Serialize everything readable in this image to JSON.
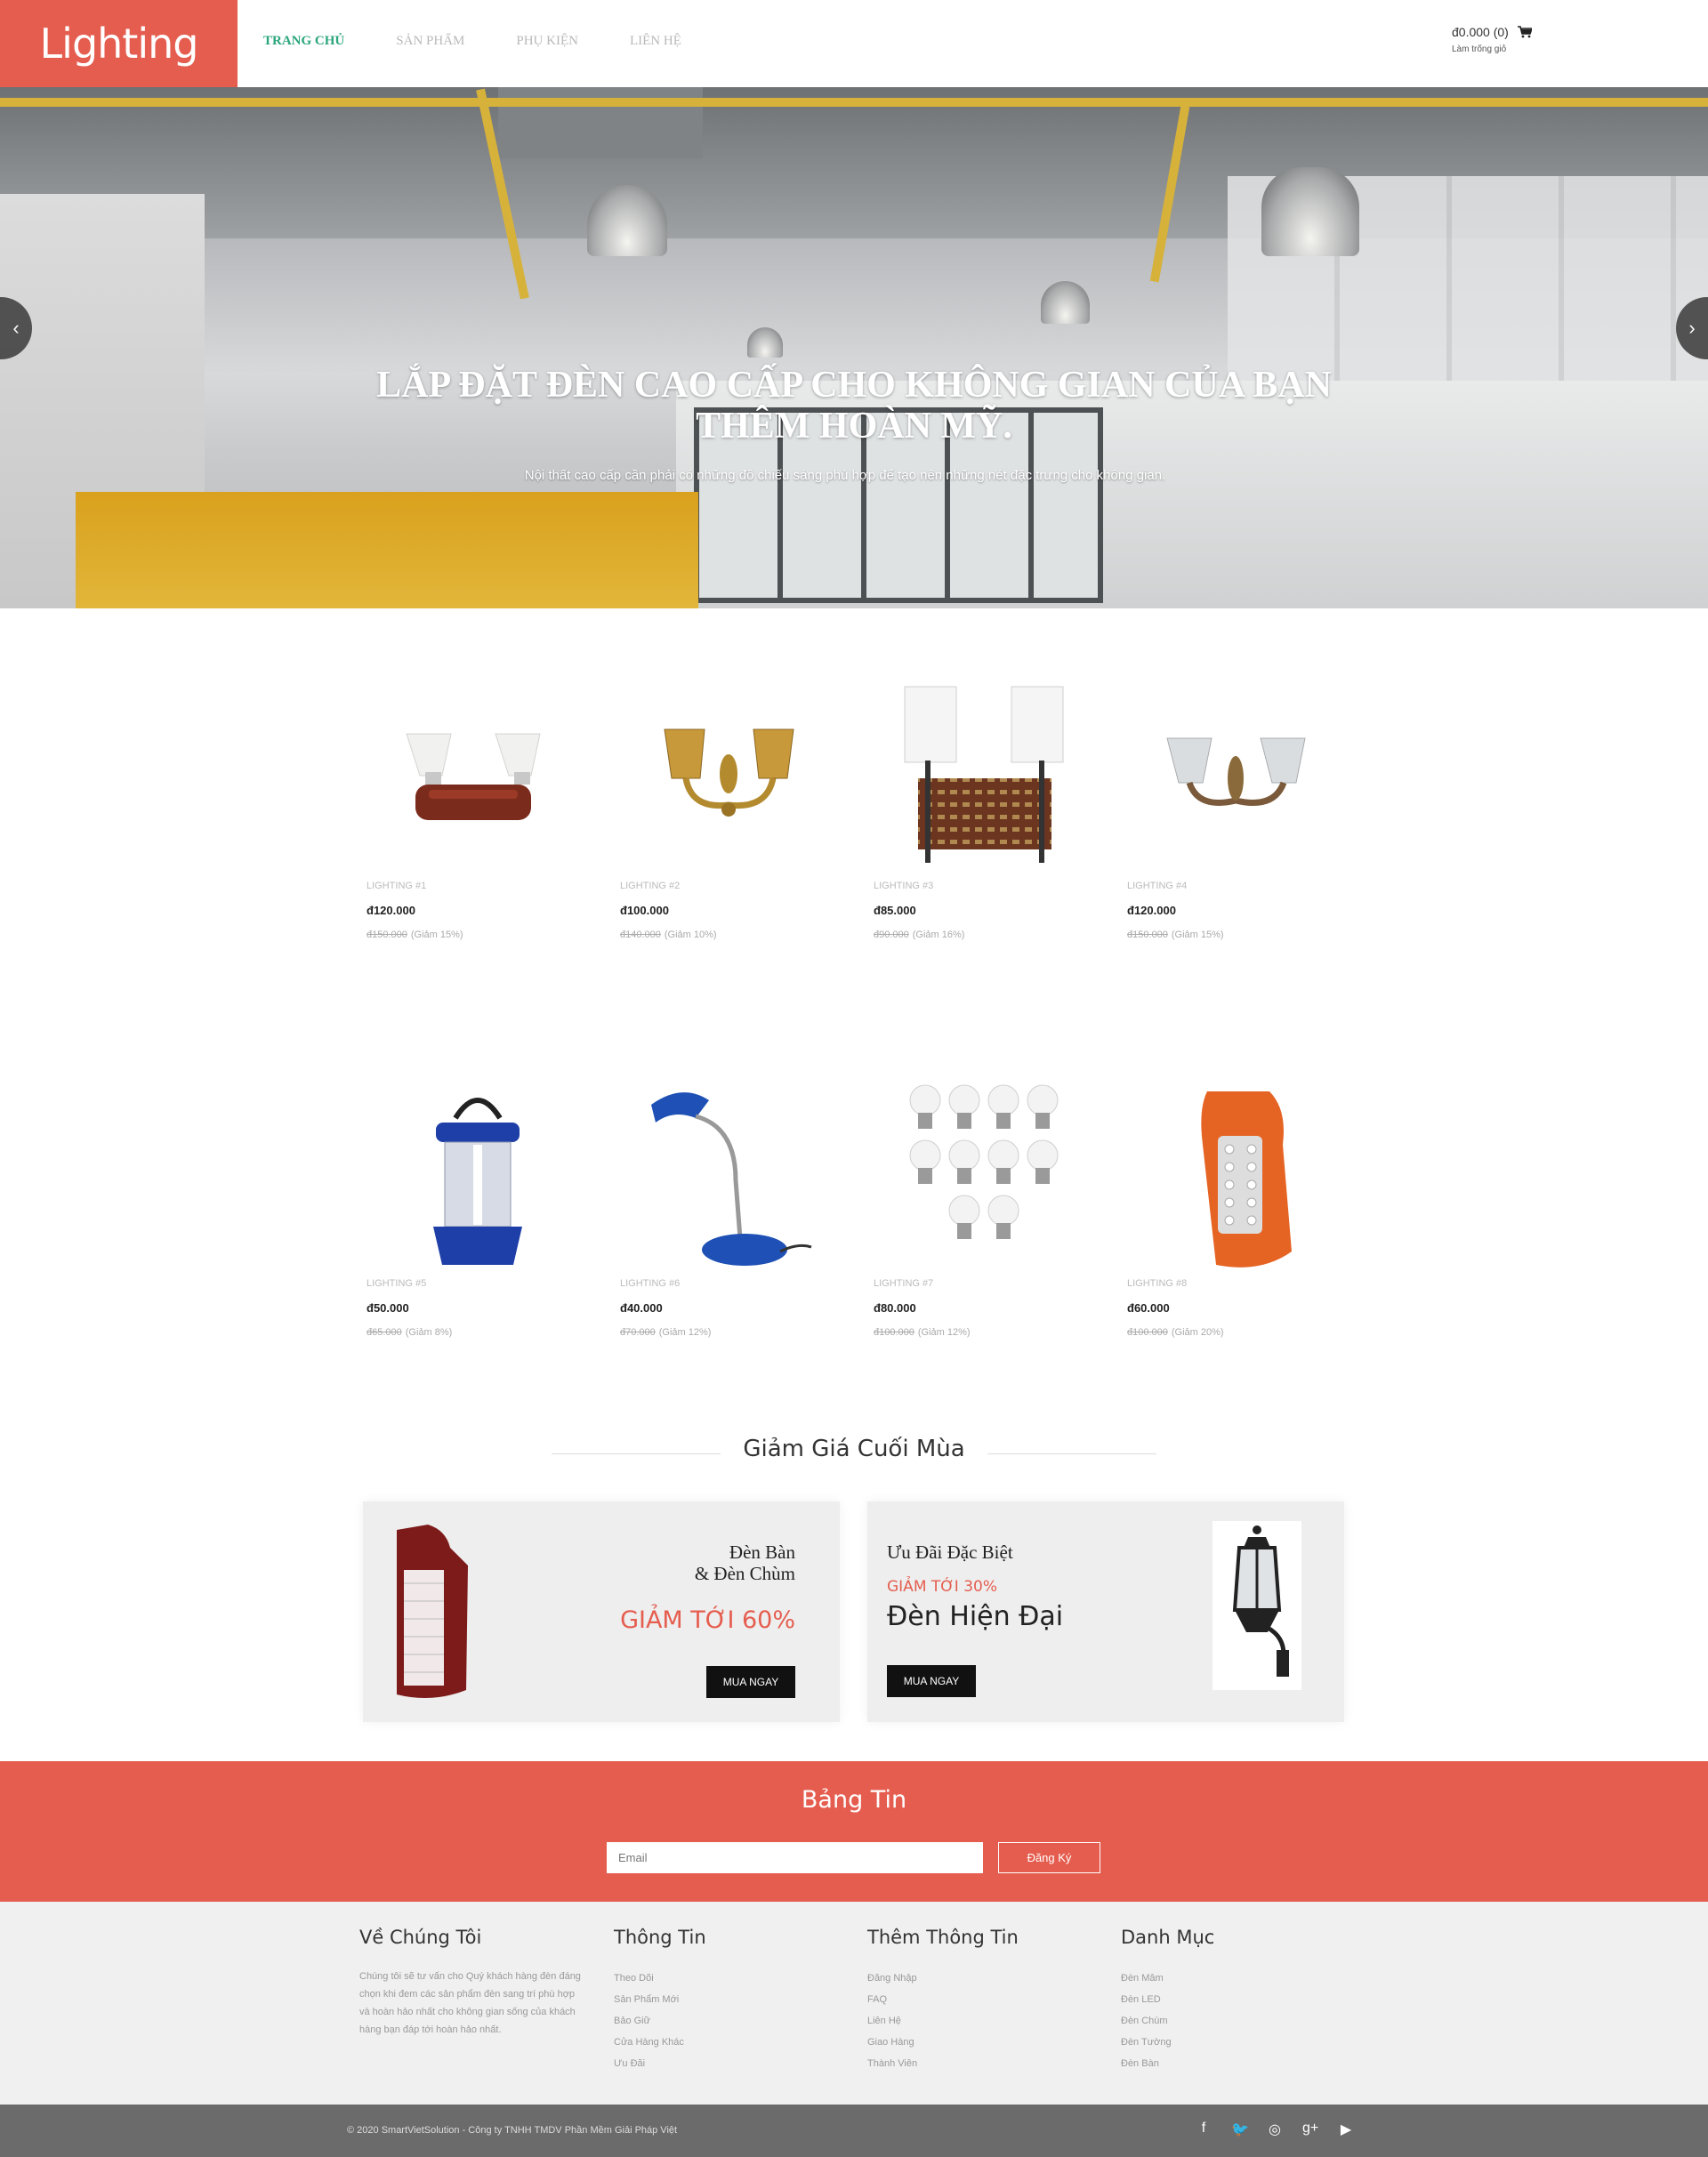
{
  "header": {
    "logo": "Lighting",
    "nav": [
      "TRANG CHỦ",
      "SẢN PHẨM",
      "PHỤ KIỆN",
      "LIÊN HỆ"
    ],
    "cart_total": "đ0.000 (0)",
    "cart_clear": "Làm trống giỏ"
  },
  "hero": {
    "title": "LẮP ĐẶT ĐÈN CAO CẤP CHO KHÔNG GIAN CỦA BẠN THÊM HOÀN MỸ.",
    "desc": "Nội thất cao cấp cần phải có những đồ chiếu sáng phù hợp để tạo nên những nét đặc trưng cho không gian."
  },
  "products": [
    {
      "name": "LIGHTING #1",
      "price": "đ120.000",
      "old_price": "đ150.000",
      "discount": "(Giảm 15%)",
      "icon": "wall-lamp-icon"
    },
    {
      "name": "LIGHTING #2",
      "price": "đ100.000",
      "old_price": "đ140.000",
      "discount": "(Giảm 10%)",
      "icon": "wall-lamp-icon"
    },
    {
      "name": "LIGHTING #3",
      "price": "đ85.000",
      "old_price": "đ90.000",
      "discount": "(Giảm 16%)",
      "icon": "wall-lamp-icon"
    },
    {
      "name": "LIGHTING #4",
      "price": "đ120.000",
      "old_price": "đ150.000",
      "discount": "(Giảm 15%)",
      "icon": "wall-lamp-icon"
    },
    {
      "name": "LIGHTING #5",
      "price": "đ50.000",
      "old_price": "đ65.000",
      "discount": "(Giảm 8%)",
      "icon": "lantern-icon"
    },
    {
      "name": "LIGHTING #6",
      "price": "đ40.000",
      "old_price": "đ70.000",
      "discount": "(Giảm 12%)",
      "icon": "desk-lamp-icon"
    },
    {
      "name": "LIGHTING #7",
      "price": "đ80.000",
      "old_price": "đ100.000",
      "discount": "(Giảm 12%)",
      "icon": "bulbs-icon"
    },
    {
      "name": "LIGHTING #8",
      "price": "đ60.000",
      "old_price": "đ100.000",
      "discount": "(Giảm 20%)",
      "icon": "emergency-lamp-icon"
    }
  ],
  "sale": {
    "title": "Giảm Giá Cuối Mùa",
    "left": {
      "line1": "Đèn Bàn",
      "line2": "& Đèn Chùm",
      "offer": "GIẢM TỚI 60%",
      "button": "MUA NGAY"
    },
    "right": {
      "line1": "Ưu Đãi Đặc Biệt",
      "offer": "GIẢM TỚI 30%",
      "headline": "Đèn Hiện Đại",
      "button": "MUA NGAY"
    }
  },
  "newsletter": {
    "title": "Bảng Tin",
    "placeholder": "Email",
    "button": "Đăng Ký"
  },
  "footer": {
    "about": {
      "title": "Về Chúng Tôi",
      "text": "Chúng tôi sẽ tư vấn cho Quý khách hàng đèn đáng chọn khi đem các sản phẩm đèn sang trí phù hợp và hoàn hảo nhất cho không gian sống của khách hàng bạn đáp tới hoàn hảo nhất."
    },
    "info": {
      "title": "Thông Tin",
      "items": [
        "Theo Dõi",
        "Sản Phẩm Mới",
        "Bảo Giữ",
        "Cửa Hàng Khác",
        "Ưu Đãi"
      ]
    },
    "more": {
      "title": "Thêm Thông Tin",
      "items": [
        "Đăng Nhập",
        "FAQ",
        "Liên Hệ",
        "Giao Hàng",
        "Thành Viên"
      ]
    },
    "cat": {
      "title": "Danh Mục",
      "items": [
        "Đèn Mâm",
        "Đèn LED",
        "Đèn Chùm",
        "Đèn Tường",
        "Đèn Bàn"
      ]
    },
    "copyright": "© 2020 SmartVietSolution - Công ty TNHH TMDV Phần Mềm Giải Pháp Việt"
  },
  "colors": {
    "accent": "#e55d4f",
    "nav_active": "#2aa57c"
  }
}
